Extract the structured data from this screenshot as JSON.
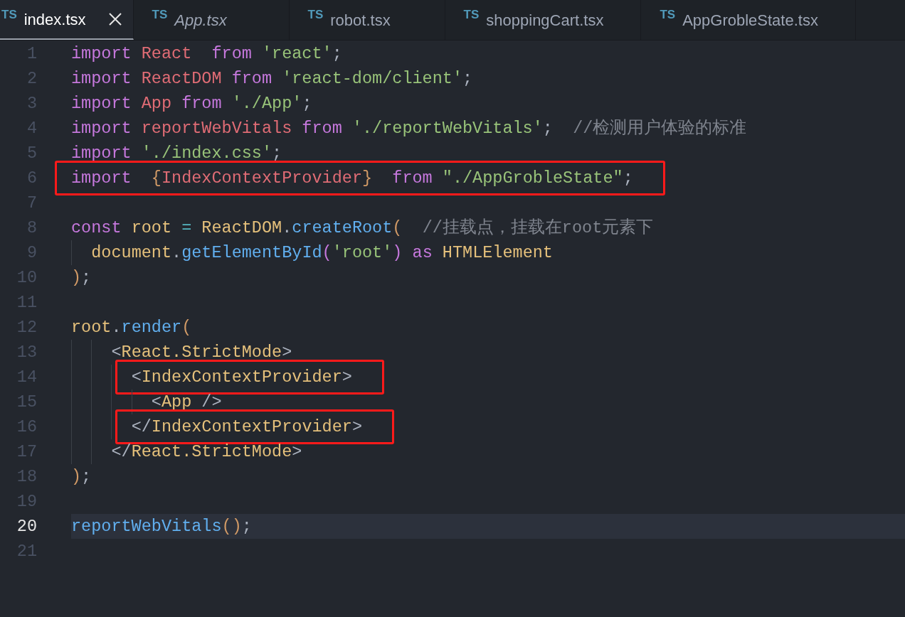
{
  "tabs": [
    {
      "label": "index.tsx",
      "badge": "TS",
      "selected": true,
      "preview": false
    },
    {
      "label": "App.tsx",
      "badge": "TS",
      "selected": false,
      "preview": true
    },
    {
      "label": "robot.tsx",
      "badge": "TS",
      "selected": false,
      "preview": false
    },
    {
      "label": "shoppingCart.tsx",
      "badge": "TS",
      "selected": false,
      "preview": false
    },
    {
      "label": "AppGrobleState.tsx",
      "badge": "TS",
      "selected": false,
      "preview": false
    }
  ],
  "lines": [
    {
      "number": "1",
      "current": false,
      "boxed": false,
      "tokens": [
        {
          "s": "import ",
          "color": "#c678dd"
        },
        {
          "s": "React  ",
          "color": "#e06c75"
        },
        {
          "s": "from ",
          "color": "#c678dd"
        },
        {
          "s": "'react'",
          "color": "#98c379"
        },
        {
          "s": ";",
          "color": "#abb2bf"
        }
      ]
    },
    {
      "number": "2",
      "current": false,
      "boxed": false,
      "tokens": [
        {
          "s": "import ",
          "color": "#c678dd"
        },
        {
          "s": "ReactDOM ",
          "color": "#e06c75"
        },
        {
          "s": "from ",
          "color": "#c678dd"
        },
        {
          "s": "'react-dom/client'",
          "color": "#98c379"
        },
        {
          "s": ";",
          "color": "#abb2bf"
        }
      ]
    },
    {
      "number": "3",
      "current": false,
      "boxed": false,
      "tokens": [
        {
          "s": "import ",
          "color": "#c678dd"
        },
        {
          "s": "App ",
          "color": "#e06c75"
        },
        {
          "s": "from ",
          "color": "#c678dd"
        },
        {
          "s": "'./App'",
          "color": "#98c379"
        },
        {
          "s": ";",
          "color": "#abb2bf"
        }
      ]
    },
    {
      "number": "4",
      "current": false,
      "boxed": false,
      "tokens": [
        {
          "s": "import ",
          "color": "#c678dd"
        },
        {
          "s": "reportWebVitals ",
          "color": "#e06c75"
        },
        {
          "s": "from ",
          "color": "#c678dd"
        },
        {
          "s": "'./reportWebVitals'",
          "color": "#98c379"
        },
        {
          "s": ";  ",
          "color": "#abb2bf"
        },
        {
          "s": "//检测用户体验的标准",
          "color": "#7f848e"
        }
      ]
    },
    {
      "number": "5",
      "current": false,
      "boxed": false,
      "tokens": [
        {
          "s": "import ",
          "color": "#c678dd"
        },
        {
          "s": "'./index.css'",
          "color": "#98c379"
        },
        {
          "s": ";",
          "color": "#abb2bf"
        }
      ]
    },
    {
      "number": "6",
      "current": false,
      "boxed": true,
      "tokens": [
        {
          "s": "import  ",
          "color": "#c678dd"
        },
        {
          "s": "{",
          "color": "#d19a66"
        },
        {
          "s": "IndexContextProvider",
          "color": "#e06c75"
        },
        {
          "s": "}  ",
          "color": "#d19a66"
        },
        {
          "s": "from ",
          "color": "#c678dd"
        },
        {
          "s": "\"./AppGrobleState\"",
          "color": "#98c379"
        },
        {
          "s": ";",
          "color": "#abb2bf"
        }
      ]
    },
    {
      "number": "7",
      "current": false,
      "boxed": false
    },
    {
      "number": "8",
      "current": false,
      "boxed": false,
      "tokens": [
        {
          "s": "const ",
          "color": "#c678dd"
        },
        {
          "s": "root ",
          "color": "#e5c07b"
        },
        {
          "s": "= ",
          "color": "#56b6c2"
        },
        {
          "s": "ReactDOM",
          "color": "#e5c07b"
        },
        {
          "s": ".",
          "color": "#abb2bf"
        },
        {
          "s": "createRoot",
          "color": "#61afef"
        },
        {
          "s": "(  ",
          "color": "#d19a66"
        },
        {
          "s": "//挂载点，挂载在root元素下",
          "color": "#7f848e"
        }
      ]
    },
    {
      "number": "9",
      "current": false,
      "boxed": false,
      "tokens": [
        {
          "s": "  document",
          "color": "#e5c07b"
        },
        {
          "s": ".",
          "color": "#abb2bf"
        },
        {
          "s": "getElementById",
          "color": "#61afef"
        },
        {
          "s": "(",
          "color": "#c678dd"
        },
        {
          "s": "'root'",
          "color": "#98c379"
        },
        {
          "s": ") as ",
          "color": "#c678dd"
        },
        {
          "s": "HTMLElement",
          "color": "#e5c07b"
        }
      ]
    },
    {
      "number": "10",
      "current": false,
      "boxed": false,
      "tokens": [
        {
          "s": ")",
          "color": "#d19a66"
        },
        {
          "s": ";",
          "color": "#abb2bf"
        }
      ]
    },
    {
      "number": "11",
      "current": false,
      "boxed": false
    },
    {
      "number": "12",
      "current": false,
      "boxed": false,
      "tokens": [
        {
          "s": "root",
          "color": "#e5c07b"
        },
        {
          "s": ".",
          "color": "#abb2bf"
        },
        {
          "s": "render",
          "color": "#61afef"
        },
        {
          "s": "(",
          "color": "#d19a66"
        }
      ]
    },
    {
      "number": "13",
      "current": false,
      "boxed": false,
      "tokens": [
        {
          "s": "    <",
          "color": "#abb2bf"
        },
        {
          "s": "React.StrictMode",
          "color": "#e5c07b"
        },
        {
          "s": ">",
          "color": "#abb2bf"
        }
      ]
    },
    {
      "number": "14",
      "current": false,
      "boxed": true,
      "tokens": [
        {
          "s": "      <",
          "color": "#abb2bf"
        },
        {
          "s": "IndexContextProvider",
          "color": "#e5c07b"
        },
        {
          "s": ">",
          "color": "#abb2bf"
        }
      ]
    },
    {
      "number": "15",
      "current": false,
      "boxed": false,
      "tokens": [
        {
          "s": "        <",
          "color": "#abb2bf"
        },
        {
          "s": "App",
          "color": "#e5c07b"
        },
        {
          "s": " />",
          "color": "#abb2bf"
        }
      ]
    },
    {
      "number": "16",
      "current": false,
      "boxed": true,
      "tokens": [
        {
          "s": "      </",
          "color": "#abb2bf"
        },
        {
          "s": "IndexContextProvider",
          "color": "#e5c07b"
        },
        {
          "s": ">",
          "color": "#abb2bf"
        }
      ]
    },
    {
      "number": "17",
      "current": false,
      "boxed": false,
      "tokens": [
        {
          "s": "    </",
          "color": "#abb2bf"
        },
        {
          "s": "React.StrictMode",
          "color": "#e5c07b"
        },
        {
          "s": ">",
          "color": "#abb2bf"
        }
      ]
    },
    {
      "number": "18",
      "current": false,
      "boxed": false,
      "tokens": [
        {
          "s": ")",
          "color": "#d19a66"
        },
        {
          "s": ";",
          "color": "#abb2bf"
        }
      ]
    },
    {
      "number": "19",
      "current": false,
      "boxed": false
    },
    {
      "number": "20",
      "current": true,
      "boxed": false,
      "tokens": [
        {
          "s": "reportWebVitals",
          "color": "#61afef"
        },
        {
          "s": "()",
          "color": "#d19a66"
        },
        {
          "s": ";",
          "color": "#abb2bf"
        }
      ]
    },
    {
      "number": "21",
      "current": false,
      "boxed": false
    }
  ]
}
